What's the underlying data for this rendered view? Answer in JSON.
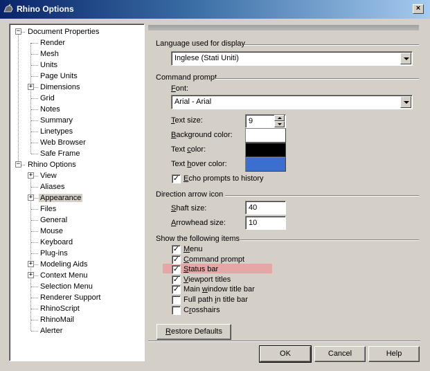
{
  "window": {
    "title": "Rhino Options",
    "close_symbol": "×"
  },
  "tree": [
    {
      "label": "Document Properties",
      "level": 0,
      "expander": "−"
    },
    {
      "label": "Render",
      "level": 1
    },
    {
      "label": "Mesh",
      "level": 1
    },
    {
      "label": "Units",
      "level": 1
    },
    {
      "label": "Page Units",
      "level": 1
    },
    {
      "label": "Dimensions",
      "level": 1,
      "expander": "+"
    },
    {
      "label": "Grid",
      "level": 1
    },
    {
      "label": "Notes",
      "level": 1
    },
    {
      "label": "Summary",
      "level": 1
    },
    {
      "label": "Linetypes",
      "level": 1
    },
    {
      "label": "Web Browser",
      "level": 1
    },
    {
      "label": "Safe Frame",
      "level": 1
    },
    {
      "label": "Rhino Options",
      "level": 0,
      "expander": "−"
    },
    {
      "label": "View",
      "level": 1,
      "expander": "+"
    },
    {
      "label": "Aliases",
      "level": 1
    },
    {
      "label": "Appearance",
      "level": 1,
      "expander": "+",
      "selected": true
    },
    {
      "label": "Files",
      "level": 1
    },
    {
      "label": "General",
      "level": 1
    },
    {
      "label": "Mouse",
      "level": 1
    },
    {
      "label": "Keyboard",
      "level": 1
    },
    {
      "label": "Plug-ins",
      "level": 1
    },
    {
      "label": "Modeling Aids",
      "level": 1,
      "expander": "+"
    },
    {
      "label": "Context Menu",
      "level": 1,
      "expander": "+"
    },
    {
      "label": "Selection Menu",
      "level": 1
    },
    {
      "label": "Renderer Support",
      "level": 1
    },
    {
      "label": "RhinoScript",
      "level": 1
    },
    {
      "label": "RhinoMail",
      "level": 1
    },
    {
      "label": "Alerter",
      "level": 1
    }
  ],
  "language": {
    "group_label": "Language used for display",
    "value": "Inglese (Stati Uniti)"
  },
  "command_prompt": {
    "group_label": "Command prompt",
    "font_label_u": "F",
    "font_label_rest": "ont:",
    "font_value": "Arial - Arial",
    "text_size_label_u": "T",
    "text_size_label_rest": "ext size:",
    "text_size_value": "9",
    "bg_color_label_u": "B",
    "bg_color_label_rest": "ackground color:",
    "bg_color": "#ffffff",
    "text_color_label_pre": "Text ",
    "text_color_label_u": "c",
    "text_color_label_rest": "olor:",
    "text_color": "#000000",
    "hover_label_pre": "Text ",
    "hover_label_u": "h",
    "hover_label_rest": "over color:",
    "hover_color": "#3a6fd0",
    "echo_label_u": "E",
    "echo_label_rest": "cho prompts to history",
    "echo_checked": true
  },
  "direction_arrow": {
    "group_label": "Direction arrow icon",
    "shaft_label_u": "S",
    "shaft_label_rest": "haft size:",
    "shaft_value": "40",
    "arrowhead_label_u": "A",
    "arrowhead_label_rest": "rrowhead size:",
    "arrowhead_value": "10"
  },
  "show_items": {
    "group_label": "Show the following items",
    "highlight_color": "#e8a0a0",
    "items": [
      {
        "pre": "",
        "u": "M",
        "rest": "enu",
        "checked": true
      },
      {
        "pre": "",
        "u": "C",
        "rest": "ommand prompt",
        "checked": true
      },
      {
        "pre": "",
        "u": "S",
        "rest": "tatus bar",
        "checked": true
      },
      {
        "pre": "",
        "u": "V",
        "rest": "iewport titles",
        "checked": true
      },
      {
        "pre": "Main ",
        "u": "w",
        "rest": "indow title bar",
        "checked": true
      },
      {
        "pre": "Full path ",
        "u": "i",
        "rest": "n title bar",
        "checked": false
      },
      {
        "pre": "C",
        "u": "r",
        "rest": "osshairs",
        "checked": false
      }
    ]
  },
  "buttons": {
    "restore_pre": "",
    "restore_u": "R",
    "restore_rest": "estore Defaults",
    "ok": "OK",
    "cancel": "Cancel",
    "help": "Help"
  },
  "check_mark": "✓"
}
